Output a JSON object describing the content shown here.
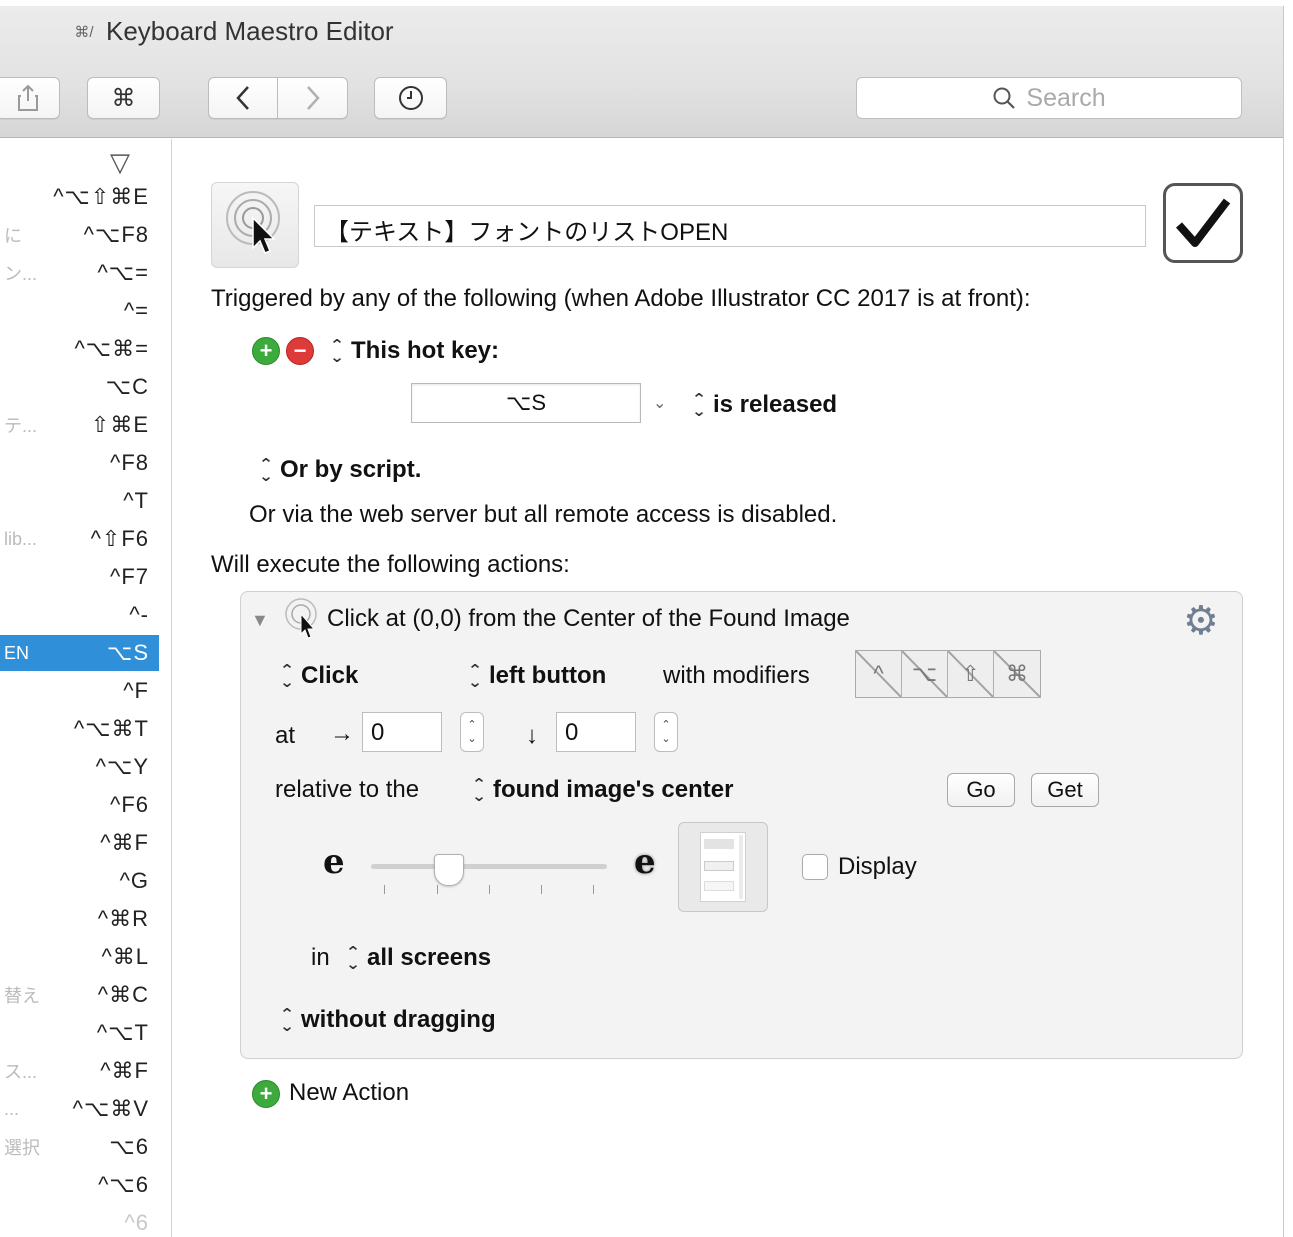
{
  "window": {
    "title": "Keyboard Maestro Editor"
  },
  "toolbar": {
    "cmd_symbol": "⌘",
    "back_symbol": "‹",
    "forward_symbol": "›",
    "history_symbol": "🕘",
    "search_placeholder": "Search"
  },
  "sidebar": {
    "sort_symbol": "▽",
    "items": [
      {
        "name": "",
        "key": "^⌥⇧⌘E"
      },
      {
        "name": "に",
        "key": "^⌥F8"
      },
      {
        "name": "ン...",
        "key": "^⌥="
      },
      {
        "name": "",
        "key": "^="
      },
      {
        "name": "",
        "key": "^⌥⌘="
      },
      {
        "name": "",
        "key": "⌥C"
      },
      {
        "name": "テ...",
        "key": "⇧⌘E"
      },
      {
        "name": "",
        "key": "^F8"
      },
      {
        "name": "",
        "key": "^T"
      },
      {
        "name": "lib...",
        "key": "^⇧F6"
      },
      {
        "name": "",
        "key": "^F7"
      },
      {
        "name": "",
        "key": "^-"
      },
      {
        "name": "EN",
        "key": "⌥S"
      },
      {
        "name": "",
        "key": "^F"
      },
      {
        "name": "",
        "key": "^⌥⌘T"
      },
      {
        "name": "",
        "key": "^⌥Y"
      },
      {
        "name": "",
        "key": "^F6"
      },
      {
        "name": "",
        "key": "^⌘F"
      },
      {
        "name": "",
        "key": "^G"
      },
      {
        "name": "",
        "key": "^⌘R"
      },
      {
        "name": "",
        "key": "^⌘L"
      },
      {
        "name": "替え",
        "key": "^⌘C"
      },
      {
        "name": "",
        "key": "^⌥T"
      },
      {
        "name": "ス...",
        "key": "^⌘F"
      },
      {
        "name": "...",
        "key": "^⌥⌘V"
      },
      {
        "name": "選択",
        "key": "⌥6"
      },
      {
        "name": "",
        "key": "^⌥6"
      },
      {
        "name": "",
        "key": "^6"
      }
    ]
  },
  "macro": {
    "name": "【テキスト】フォントのリストOPEN",
    "enabled": true,
    "triggered_by": "Triggered by any of the following (when Adobe Illustrator CC 2017 is at front):",
    "trigger_type": "This hot key:",
    "hotkey": "⌥S",
    "hotkey_state": "is released",
    "or_by_script": "Or by script.",
    "web_server": "Or via the web server but all remote access is disabled.",
    "will_execute": "Will execute the following actions:"
  },
  "action": {
    "title": "Click at (0,0) from the Center of the Found Image",
    "click_type": "Click",
    "button": "left button",
    "with_modifiers": "with modifiers",
    "modifiers": [
      "^",
      "⌥",
      "⇧",
      "⌘"
    ],
    "at_label": "at",
    "right_arrow": "→",
    "down_arrow": "↓",
    "x_value": "0",
    "y_value": "0",
    "relative_label": "relative to the",
    "relative_to": "found image's center",
    "go_label": "Go",
    "get_label": "Get",
    "fuzz_small": "e",
    "fuzz_large": "e",
    "fuzz_level": 0.33,
    "display_label": "Display",
    "in_label": "in",
    "screens": "all screens",
    "dragging": "without dragging"
  },
  "new_action_label": "New Action"
}
